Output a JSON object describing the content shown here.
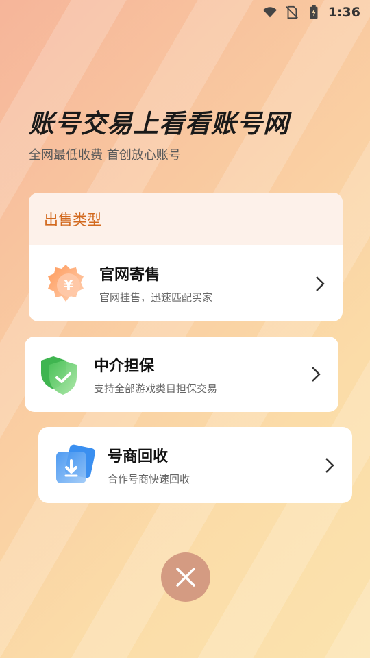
{
  "status_bar": {
    "time": "1:36",
    "icons": [
      "wifi-icon",
      "no-sim-icon",
      "battery-charging-icon"
    ]
  },
  "header": {
    "title": "账号交易上看看账号网",
    "subtitle": "全网最低收费 首创放心账号"
  },
  "sale_types": {
    "section_title": "出售类型",
    "items": [
      {
        "title": "官网寄售",
        "desc": "官网挂售，迅速匹配买家",
        "icon": "yuan-badge-icon"
      },
      {
        "title": "中介担保",
        "desc": "支持全部游戏类目担保交易",
        "icon": "shield-check-icon"
      },
      {
        "title": "号商回收",
        "desc": "合作号商快速回收",
        "icon": "download-box-icon"
      }
    ]
  },
  "colors": {
    "accent_orange": "#d2691e",
    "header_bg": "#fdf1ea",
    "close_button": "#d49b82"
  }
}
